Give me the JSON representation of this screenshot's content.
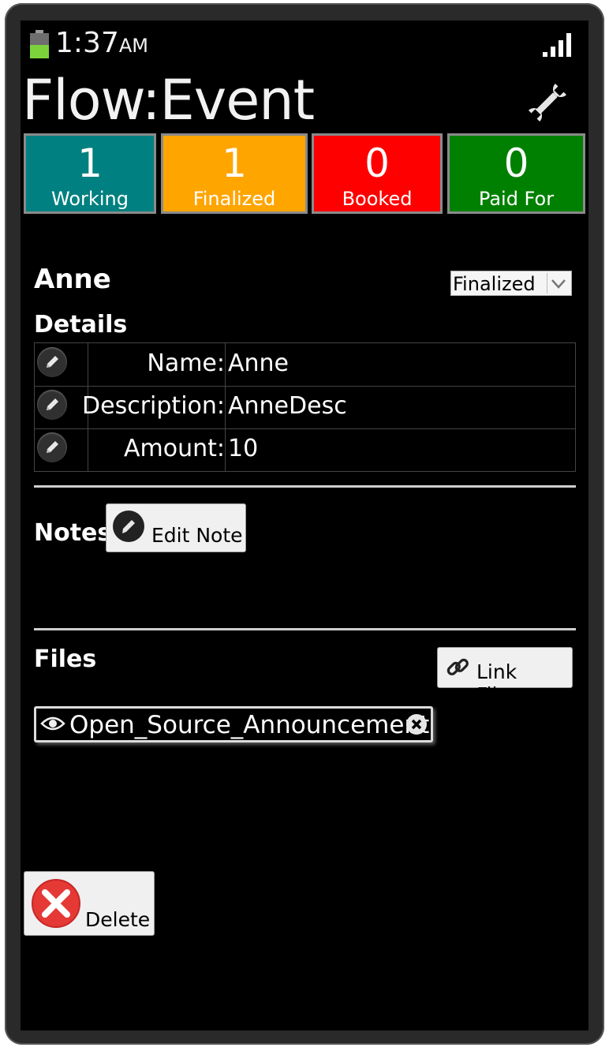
{
  "status_bar": {
    "time": "1:37",
    "ampm": "AM"
  },
  "app": {
    "title": "Flow:Event",
    "settings_icon": "wrench-icon"
  },
  "counters": [
    {
      "count": "1",
      "label": "Working",
      "color": "#008080"
    },
    {
      "count": "1",
      "label": "Finalized",
      "color": "#ffa500"
    },
    {
      "count": "0",
      "label": "Booked",
      "color": "#ff0000"
    },
    {
      "count": "0",
      "label": "Paid For",
      "color": "#008000"
    }
  ],
  "record": {
    "name": "Anne",
    "state": {
      "selected": "Finalized"
    }
  },
  "details": {
    "heading": "Details",
    "rows": [
      {
        "label": "Name:",
        "value": "Anne"
      },
      {
        "label": "Description:",
        "value": "AnneDesc"
      },
      {
        "label": "Amount:",
        "value": "10"
      }
    ]
  },
  "notes": {
    "heading": "Notes",
    "edit_label": "Edit Note"
  },
  "files": {
    "heading": "Files",
    "link_label": "Link File...",
    "items": [
      {
        "name": "Open_Source_Announcement"
      }
    ]
  },
  "actions": {
    "delete_label": "Delete"
  }
}
